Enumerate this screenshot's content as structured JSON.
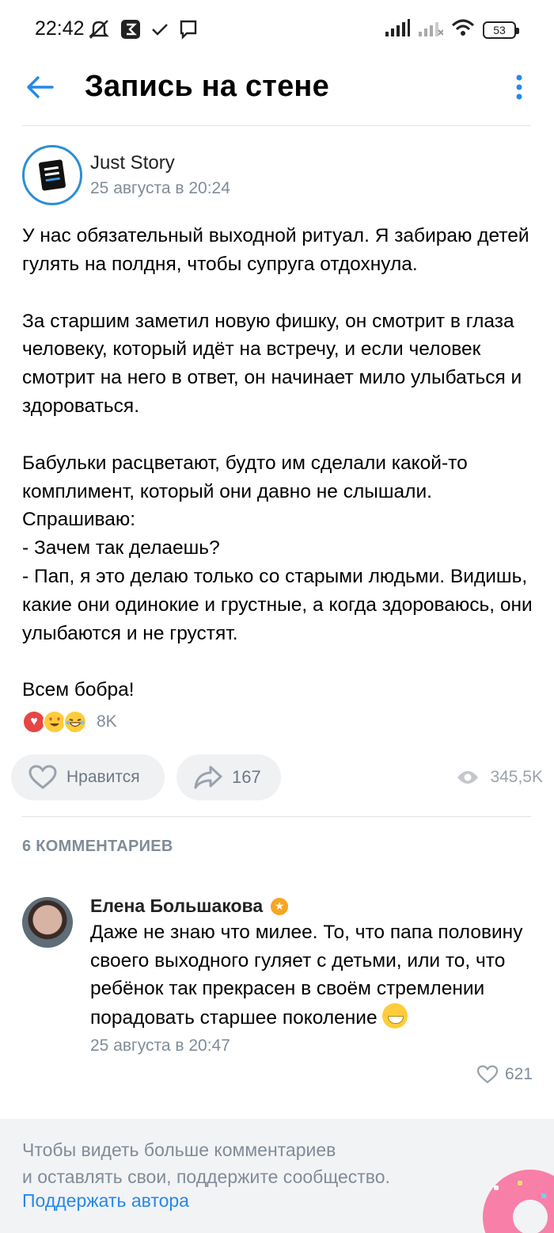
{
  "status_bar": {
    "time": "22:42",
    "battery": "53",
    "icons": [
      "mute-icon",
      "app-icon",
      "check-icon",
      "message-icon",
      "signal-icon",
      "signal-icon",
      "wifi-icon",
      "battery-icon"
    ]
  },
  "header": {
    "title": "Запись на стене",
    "back_icon": "back-arrow-icon",
    "more_icon": "more-vertical-icon",
    "accent_color": "#2688eb"
  },
  "post": {
    "author": "Just Story",
    "date": "25 августа в 20:24",
    "paragraphs": [
      "У нас обязательный выходной ритуал. Я забираю детей гулять на полдня, чтобы супруга отдохнула.",
      "За старшим заметил новую фишку, он смотрит в глаза человеку, который идёт на встречу, и если человек смотрит на него в ответ, он начинает мило улыбаться и здороваться.",
      "Бабульки расцветают, будто им сделали какой-то комплимент, который они давно не слышали.\nСпрашиваю:\n- Зачем так делаешь?\n- Пап, я это делаю только со старыми людьми. Видишь, какие они одинокие и грустные, а когда здороваюсь, они улыбаются и не грустят.",
      "Всем бобра!"
    ],
    "reactions_count": "8K",
    "like_label": "Нравится",
    "shares": "167",
    "views": "345,5K"
  },
  "comments": {
    "header": "6 КОММЕНТАРИЕВ",
    "items": [
      {
        "name": "Елена Большакова",
        "text": "Даже не знаю что милее. То, что папа половину своего выходного гуляет с детьми, или то, что ребёнок так прекрасен в своём стремлении порадовать старшее поколение",
        "date": "25 августа в 20:47",
        "likes": "621"
      }
    ]
  },
  "support": {
    "text": "Чтобы видеть больше комментариев\nи оставлять свои, поддержите сообщество.",
    "link": "Поддержать автора"
  }
}
